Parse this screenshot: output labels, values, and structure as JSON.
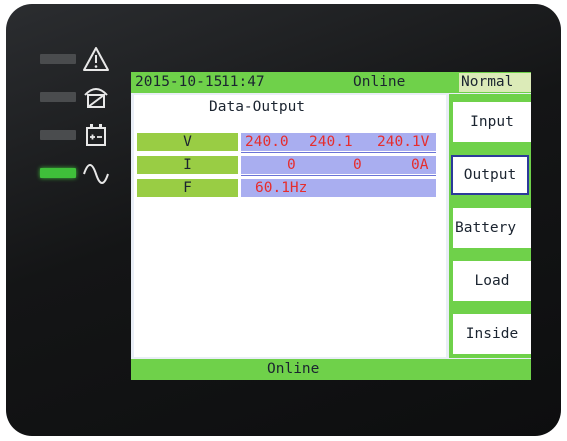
{
  "status_bar": {
    "date": "2015-10-15",
    "time": "11:47",
    "mode": "Online",
    "state": "Normal"
  },
  "leds": [
    {
      "name": "fault",
      "icon": "warning-icon",
      "on": false
    },
    {
      "name": "bypass",
      "icon": "bypass-icon",
      "on": false
    },
    {
      "name": "battery",
      "icon": "battery-icon",
      "on": false
    },
    {
      "name": "output",
      "icon": "sine-wave-icon",
      "on": true
    }
  ],
  "data_output": {
    "title": "Data-Output",
    "rows": [
      {
        "label": "V",
        "values": [
          "240.0",
          "240.1",
          "240.1V"
        ]
      },
      {
        "label": "I",
        "values": [
          "0",
          "0",
          "0A"
        ]
      },
      {
        "label": "F",
        "values": [
          "60.1Hz"
        ]
      }
    ]
  },
  "menu": {
    "items": [
      "Input",
      "Output",
      "Battery",
      "Load",
      "Inside"
    ],
    "active": "Output"
  },
  "bottom_bar": {
    "status": "Online"
  },
  "colors": {
    "lcd_green": "#6fd14a",
    "label_green": "#99cd44",
    "value_bg": "#a9aef0",
    "value_text": "#e62d2d",
    "led_on": "#3fbf3a",
    "led_off": "#4a4c4e"
  }
}
